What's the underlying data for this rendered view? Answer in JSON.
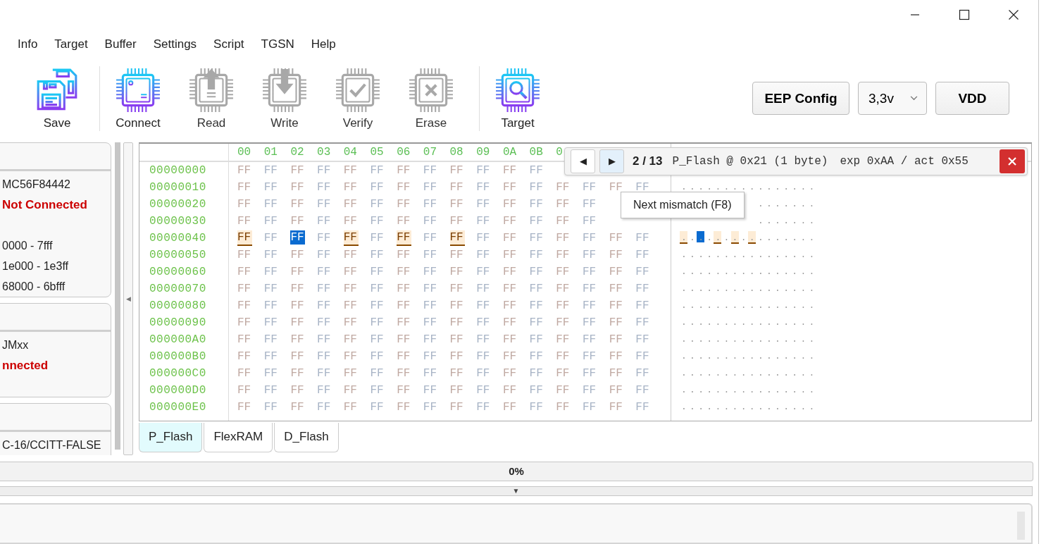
{
  "menu": [
    "Info",
    "Target",
    "Buffer",
    "Settings",
    "Script",
    "TGSN",
    "Help"
  ],
  "toolbar": [
    {
      "kind": "save",
      "label": "Save",
      "disabled": false
    },
    {
      "kind": "separator"
    },
    {
      "kind": "chip",
      "label": "Connect",
      "disabled": false
    },
    {
      "kind": "chip-up",
      "label": "Read",
      "disabled": true
    },
    {
      "kind": "chip-down",
      "label": "Write",
      "disabled": true
    },
    {
      "kind": "chip-check",
      "label": "Verify",
      "disabled": true
    },
    {
      "kind": "chip-x",
      "label": "Erase",
      "disabled": true
    },
    {
      "kind": "separator"
    },
    {
      "kind": "chip-search",
      "label": "Target",
      "disabled": false
    }
  ],
  "device_controls": {
    "eep_config": "EEP Config",
    "voltage": "3,3v",
    "vdd": "VDD"
  },
  "device_cards": [
    {
      "lines": [
        {
          "kind": "text",
          "text": "MC56F84442"
        },
        {
          "kind": "status",
          "text": "Not Connected"
        },
        {
          "kind": "blank"
        },
        {
          "kind": "text",
          "text": "0000 - 7fff"
        },
        {
          "kind": "text",
          "text": "1e000 - 1e3ff"
        },
        {
          "kind": "text",
          "text": "68000 - 6bfff"
        }
      ]
    },
    {
      "lines": [
        {
          "kind": "text",
          "text": "JMxx"
        },
        {
          "kind": "status",
          "text": "nnected"
        }
      ]
    },
    {
      "lines": [
        {
          "kind": "text",
          "text": "C-16/CCITT-FALSE"
        }
      ]
    }
  ],
  "splitter": {
    "glyph": "◀"
  },
  "hex_view": {
    "columns": [
      "00",
      "01",
      "02",
      "03",
      "04",
      "05",
      "06",
      "07",
      "08",
      "09",
      "0A",
      "0B",
      "0"
    ],
    "rows": [
      {
        "address": "00000000",
        "bytes": [
          "FF",
          "FF",
          "FF",
          "FF",
          "FF",
          "FF",
          "FF",
          "FF",
          "FF",
          "FF",
          "FF",
          "FF"
        ]
      },
      {
        "address": "00000010",
        "bytes": [
          "FF",
          "FF",
          "FF",
          "FF",
          "FF",
          "FF",
          "FF",
          "FF",
          "FF",
          "FF",
          "FF",
          "FF",
          "FF",
          "FF",
          "FF",
          "FF"
        ],
        "ascii": "................"
      },
      {
        "address": "00000020",
        "bytes": [
          "FF",
          "FF",
          "FF",
          "FF",
          "FF",
          "FF",
          "FF",
          "FF",
          "FF",
          "FF",
          "FF",
          "FF",
          "FF",
          "FF"
        ],
        "ascii": "......."
      },
      {
        "address": "00000030",
        "bytes": [
          "FF",
          "FF",
          "FF",
          "FF",
          "FF",
          "FF",
          "FF",
          "FF",
          "FF",
          "FF",
          "FF",
          "FF",
          "FF",
          "FF"
        ],
        "ascii": "......."
      },
      {
        "address": "00000040",
        "ascii": "................",
        "bytes": [
          {
            "text": "FF",
            "mismatch": true,
            "selected": false
          },
          {
            "text": "FF",
            "mismatch": false,
            "selected": false
          },
          {
            "text": "FF",
            "mismatch": true,
            "selected": true
          },
          {
            "text": "FF",
            "mismatch": false,
            "selected": false
          },
          {
            "text": "FF",
            "mismatch": true,
            "selected": false
          },
          {
            "text": "FF",
            "mismatch": false,
            "selected": false
          },
          {
            "text": "FF",
            "mismatch": true,
            "selected": false
          },
          {
            "text": "FF",
            "mismatch": false,
            "selected": false
          },
          {
            "text": "FF",
            "mismatch": true,
            "selected": false
          },
          {
            "text": "FF",
            "mismatch": false,
            "selected": false
          },
          {
            "text": "FF",
            "mismatch": false,
            "selected": false
          },
          {
            "text": "FF",
            "mismatch": false,
            "selected": false
          },
          {
            "text": "FF",
            "mismatch": false,
            "selected": false
          },
          {
            "text": "FF",
            "mismatch": false,
            "selected": false
          },
          {
            "text": "FF",
            "mismatch": false,
            "selected": false
          },
          {
            "text": "FF",
            "mismatch": false,
            "selected": false
          }
        ]
      },
      {
        "address": "00000050",
        "bytes": [
          "FF",
          "FF",
          "FF",
          "FF",
          "FF",
          "FF",
          "FF",
          "FF",
          "FF",
          "FF",
          "FF",
          "FF",
          "FF",
          "FF",
          "FF",
          "FF"
        ],
        "ascii": "................"
      },
      {
        "address": "00000060",
        "bytes": [
          "FF",
          "FF",
          "FF",
          "FF",
          "FF",
          "FF",
          "FF",
          "FF",
          "FF",
          "FF",
          "FF",
          "FF",
          "FF",
          "FF",
          "FF",
          "FF"
        ],
        "ascii": "................"
      },
      {
        "address": "00000070",
        "bytes": [
          "FF",
          "FF",
          "FF",
          "FF",
          "FF",
          "FF",
          "FF",
          "FF",
          "FF",
          "FF",
          "FF",
          "FF",
          "FF",
          "FF",
          "FF",
          "FF"
        ],
        "ascii": "................"
      },
      {
        "address": "00000080",
        "bytes": [
          "FF",
          "FF",
          "FF",
          "FF",
          "FF",
          "FF",
          "FF",
          "FF",
          "FF",
          "FF",
          "FF",
          "FF",
          "FF",
          "FF",
          "FF",
          "FF"
        ],
        "ascii": "................"
      },
      {
        "address": "00000090",
        "bytes": [
          "FF",
          "FF",
          "FF",
          "FF",
          "FF",
          "FF",
          "FF",
          "FF",
          "FF",
          "FF",
          "FF",
          "FF",
          "FF",
          "FF",
          "FF",
          "FF"
        ],
        "ascii": "................"
      },
      {
        "address": "000000A0",
        "bytes": [
          "FF",
          "FF",
          "FF",
          "FF",
          "FF",
          "FF",
          "FF",
          "FF",
          "FF",
          "FF",
          "FF",
          "FF",
          "FF",
          "FF",
          "FF",
          "FF"
        ],
        "ascii": "................"
      },
      {
        "address": "000000B0",
        "bytes": [
          "FF",
          "FF",
          "FF",
          "FF",
          "FF",
          "FF",
          "FF",
          "FF",
          "FF",
          "FF",
          "FF",
          "FF",
          "FF",
          "FF",
          "FF",
          "FF"
        ],
        "ascii": "................"
      },
      {
        "address": "000000C0",
        "bytes": [
          "FF",
          "FF",
          "FF",
          "FF",
          "FF",
          "FF",
          "FF",
          "FF",
          "FF",
          "FF",
          "FF",
          "FF",
          "FF",
          "FF",
          "FF",
          "FF"
        ],
        "ascii": "................"
      },
      {
        "address": "000000D0",
        "bytes": [
          "FF",
          "FF",
          "FF",
          "FF",
          "FF",
          "FF",
          "FF",
          "FF",
          "FF",
          "FF",
          "FF",
          "FF",
          "FF",
          "FF",
          "FF",
          "FF"
        ],
        "ascii": "................"
      },
      {
        "address": "000000E0",
        "bytes": [
          "FF",
          "FF",
          "FF",
          "FF",
          "FF",
          "FF",
          "FF",
          "FF",
          "FF",
          "FF",
          "FF",
          "FF",
          "FF",
          "FF",
          "FF",
          "FF"
        ],
        "ascii": "................"
      }
    ],
    "mismatch_bar": {
      "prev": "◀",
      "next": "▶",
      "next_hovered": true,
      "counter": "2 / 13",
      "location": "P_Flash @ 0x21 (1 byte)",
      "values": "exp 0xAA / act 0x55"
    },
    "tooltip": "Next mismatch (F8)"
  },
  "memory_tabs": [
    {
      "label": "P_Flash",
      "selected": true
    },
    {
      "label": "FlexRAM",
      "selected": false
    },
    {
      "label": "D_Flash",
      "selected": false
    }
  ],
  "progress": {
    "label": "0%",
    "level": 0
  },
  "collapse_bar": {
    "glyph": "▼"
  }
}
